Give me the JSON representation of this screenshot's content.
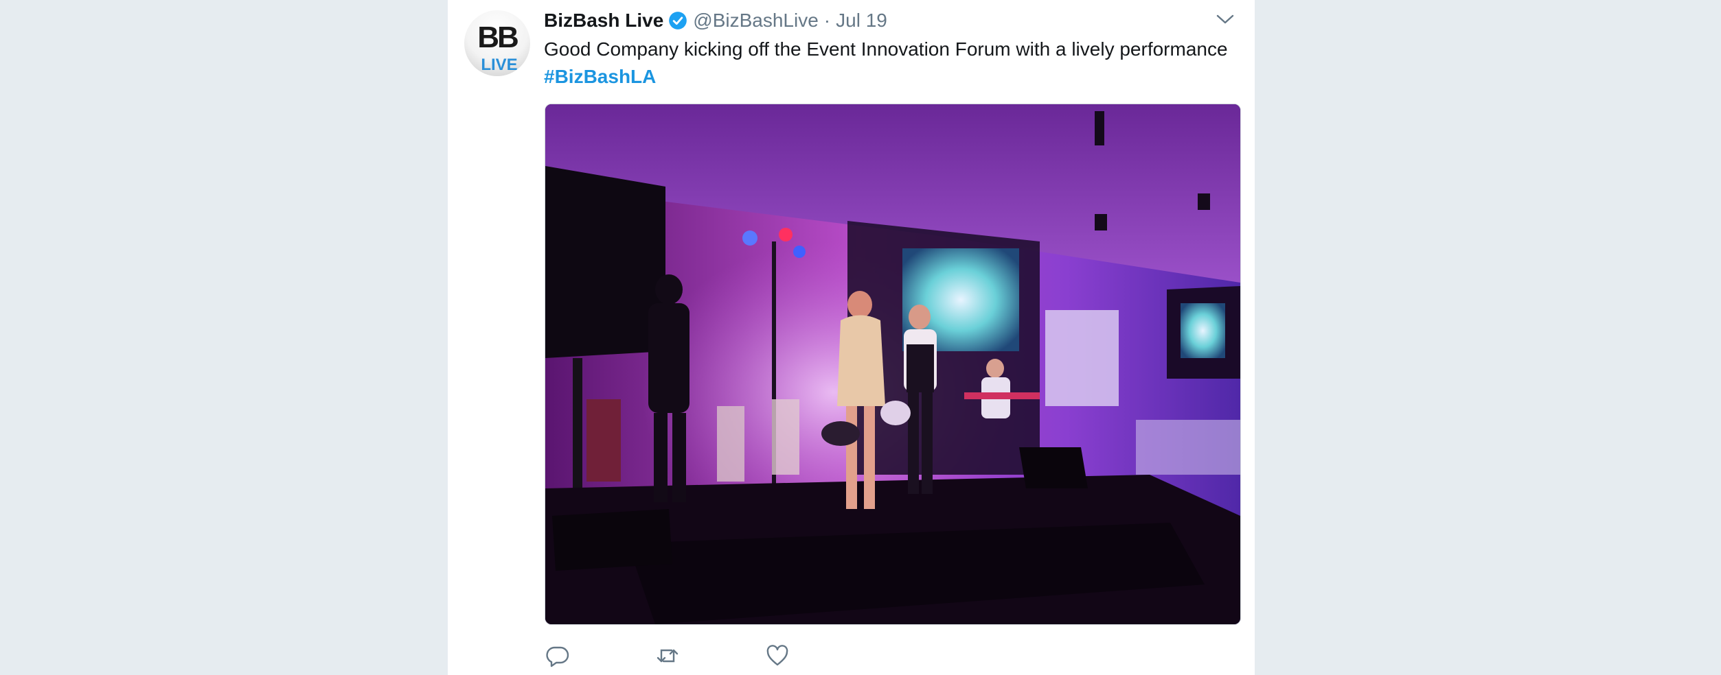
{
  "tweet": {
    "author_name": "BizBash Live",
    "handle": "@BizBashLive",
    "separator": "·",
    "date": "Jul 19",
    "text": "Good Company kicking off the Event Innovation Forum with a lively performance",
    "hashtag": "#BizBashLA",
    "avatar_text_top": "BB",
    "avatar_text_bottom": "LIVE",
    "media_alt": "Band performing on stage at Event Innovation Forum"
  },
  "icons": {
    "verified": "verified-badge-icon",
    "caret": "chevron-down-icon",
    "reply": "reply-icon",
    "retweet": "retweet-icon",
    "like": "heart-icon"
  },
  "colors": {
    "background": "#e6ecf0",
    "card": "#ffffff",
    "text": "#14171a",
    "secondary": "#657786",
    "link": "#1b95e0",
    "verified": "#1da1f2"
  }
}
